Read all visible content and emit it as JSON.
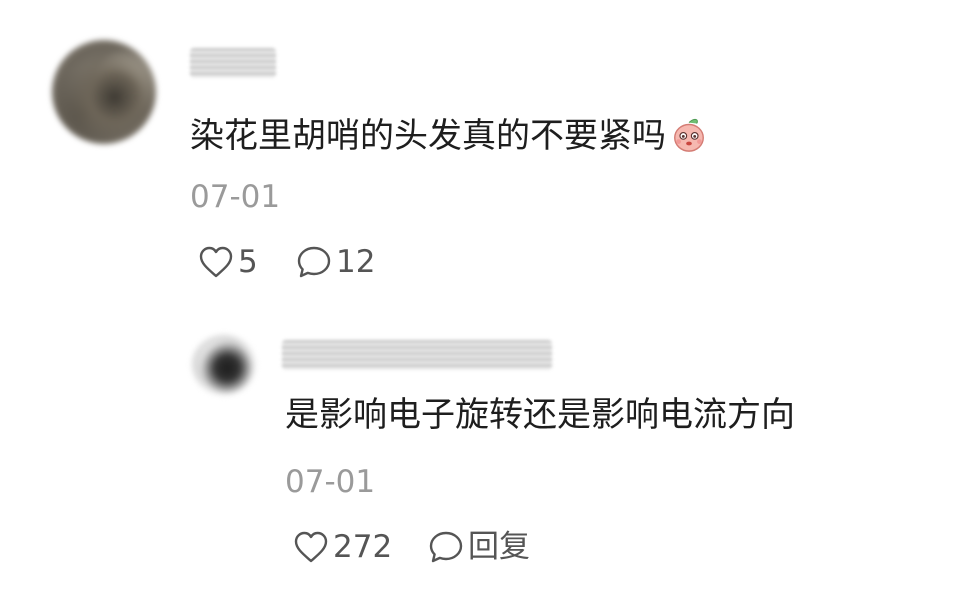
{
  "comments": [
    {
      "text": "染花里胡哨的头发真的不要紧吗",
      "emoji": "peach-face-emoji",
      "timestamp": "07-01",
      "likes": "5",
      "replies": "12"
    },
    {
      "text": "是影响电子旋转还是影响电流方向",
      "timestamp": "07-01",
      "likes": "272",
      "reply_label": "回复"
    }
  ],
  "icons": {
    "like": "heart-outline-icon",
    "reply": "speech-bubble-icon"
  },
  "colors": {
    "text": "#1e1e1e",
    "meta": "#9a9a9a",
    "action": "#555555"
  }
}
